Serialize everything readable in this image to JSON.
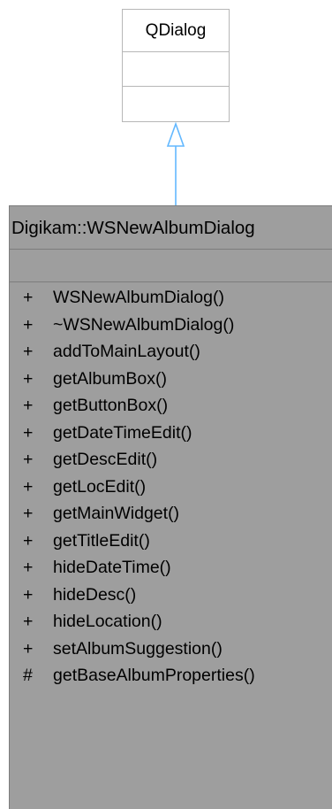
{
  "base_class": {
    "name": "QDialog"
  },
  "derived_class": {
    "name": "Digikam::WSNewAlbumDialog",
    "methods": [
      {
        "visibility": "+",
        "name": "WSNewAlbumDialog()"
      },
      {
        "visibility": "+",
        "name": "~WSNewAlbumDialog()"
      },
      {
        "visibility": "+",
        "name": "addToMainLayout()"
      },
      {
        "visibility": "+",
        "name": "getAlbumBox()"
      },
      {
        "visibility": "+",
        "name": "getButtonBox()"
      },
      {
        "visibility": "+",
        "name": "getDateTimeEdit()"
      },
      {
        "visibility": "+",
        "name": "getDescEdit()"
      },
      {
        "visibility": "+",
        "name": "getLocEdit()"
      },
      {
        "visibility": "+",
        "name": "getMainWidget()"
      },
      {
        "visibility": "+",
        "name": "getTitleEdit()"
      },
      {
        "visibility": "+",
        "name": "hideDateTime()"
      },
      {
        "visibility": "+",
        "name": "hideDesc()"
      },
      {
        "visibility": "+",
        "name": "hideLocation()"
      },
      {
        "visibility": "+",
        "name": "setAlbumSuggestion()"
      },
      {
        "visibility": "#",
        "name": "getBaseAlbumProperties()"
      }
    ]
  },
  "colors": {
    "base_border": "#b7b7b7",
    "derived_fill": "#9e9e9e",
    "derived_border": "#7c7c7c",
    "inheritance_arrow": "#63b8ff"
  }
}
